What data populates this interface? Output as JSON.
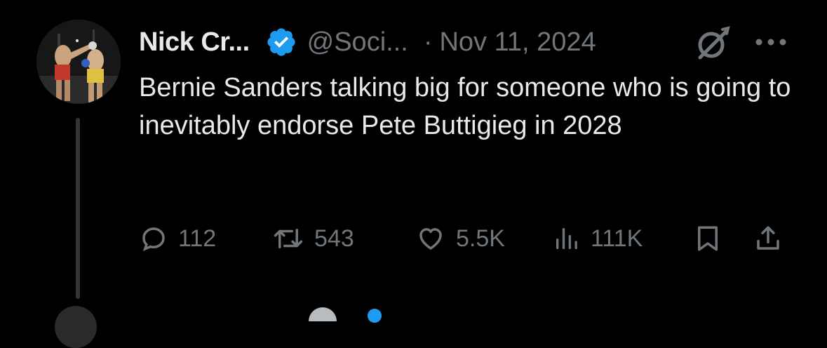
{
  "tweet": {
    "author": {
      "display_name": "Nick Cr...",
      "handle": "@Soci...",
      "verified": true
    },
    "separator": "·",
    "date": "Nov 11, 2024",
    "text": "Bernie Sanders talking big for someone who is going to inevitably endorse Pete Buttigieg in 2028",
    "stats": {
      "replies": "112",
      "reposts": "543",
      "likes": "5.5K",
      "views": "111K"
    },
    "icons": {
      "grok": "grok-icon",
      "more": "more-icon",
      "reply": "reply-icon",
      "repost": "repost-icon",
      "like": "heart-icon",
      "views": "views-icon",
      "bookmark": "bookmark-icon",
      "share": "share-icon"
    }
  },
  "theme": {
    "background": "#000000",
    "text": "#e7e9ea",
    "muted": "#71767b",
    "verified_blue": "#1d9bf0",
    "thread_line": "#333639"
  }
}
